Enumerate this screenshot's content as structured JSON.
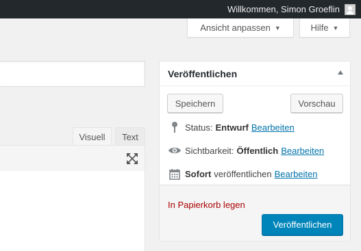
{
  "adminbar": {
    "greeting": "Willkommen, Simon Groeflin"
  },
  "screen_meta": {
    "screen_options_label": "Ansicht anpassen",
    "help_label": "Hilfe"
  },
  "editor": {
    "tab_visual": "Visuell",
    "tab_text": "Text"
  },
  "publish_box": {
    "title": "Veröffentlichen",
    "save_label": "Speichern",
    "preview_label": "Vorschau",
    "status_label": "Status:",
    "status_value": "Entwurf",
    "visibility_label": "Sichtbarkeit:",
    "visibility_value": "Öffentlich",
    "schedule_value": "Sofort",
    "schedule_label": "veröffentlichen",
    "edit_link": "Bearbeiten",
    "trash_label": "In Papierkorb legen",
    "publish_label": "Veröffentlichen"
  },
  "colors": {
    "adminbar_bg": "#23282d",
    "primary_button": "#0085ba",
    "link": "#0073aa",
    "trash": "#aa0000"
  }
}
